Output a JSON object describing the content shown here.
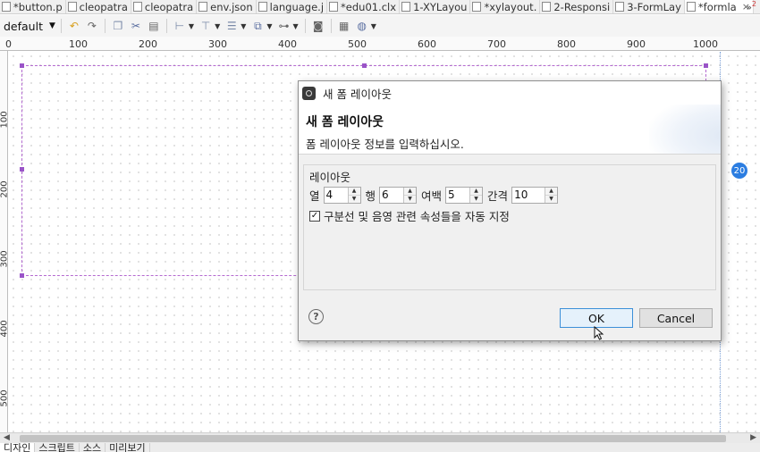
{
  "tabs": [
    {
      "label": "*button.p",
      "active": false
    },
    {
      "label": "cleopatra",
      "active": false
    },
    {
      "label": "cleopatra",
      "active": false
    },
    {
      "label": "env.json",
      "active": false
    },
    {
      "label": "language.j",
      "active": false
    },
    {
      "label": "*edu01.clx",
      "active": false
    },
    {
      "label": "1-XYLayou",
      "active": false
    },
    {
      "label": "*xylayout.",
      "active": false
    },
    {
      "label": "2-Responsi",
      "active": false
    },
    {
      "label": "3-FormLay",
      "active": false
    },
    {
      "label": "*formla",
      "active": true
    }
  ],
  "tab_close_label": "×",
  "tab_overflow": {
    "label": "»",
    "count": "2"
  },
  "toolbar": {
    "theme_combo": {
      "value": "default"
    },
    "buttons": [
      "undo-icon",
      "redo-icon",
      "copy-icon",
      "cut-icon",
      "paste-icon",
      "align-left-icon",
      "align-top-icon",
      "distribute-icon",
      "group-icon",
      "link-icon",
      "screenshot-icon",
      "qr-icon",
      "globe-icon"
    ]
  },
  "ruler": {
    "h_labels": [
      "0",
      "100",
      "200",
      "300",
      "400",
      "500",
      "600",
      "700",
      "800",
      "900",
      "1000"
    ],
    "v_labels": [
      "100",
      "200",
      "300",
      "400",
      "500"
    ]
  },
  "canvas": {
    "badge": "20"
  },
  "bottom_tabs": [
    {
      "label": "디자인",
      "active": true
    },
    {
      "label": "스크립트",
      "active": false
    },
    {
      "label": "소스",
      "active": false
    },
    {
      "label": "미리보기",
      "active": false
    }
  ],
  "dialog": {
    "title": "새 폼 레이아웃",
    "heading": "새 폼 레이아웃",
    "description": "폼 레이아웃 정보를 입력하십시오.",
    "group_label": "레이아웃",
    "fields": {
      "columns": {
        "label": "열",
        "value": "4"
      },
      "rows": {
        "label": "행",
        "value": "6"
      },
      "margin": {
        "label": "여백",
        "value": "5"
      },
      "spacing": {
        "label": "간격",
        "value": "10"
      }
    },
    "auto_checkbox": {
      "label": "구분선 및 음영 관련 속성들을 자동 지정",
      "checked": true
    },
    "help_label": "?",
    "ok_label": "OK",
    "cancel_label": "Cancel"
  },
  "colors": {
    "selection": "#b46ad0",
    "accent": "#2b7de1",
    "dialog_bg": "#f0f0f0",
    "default_button_border": "#3c8fd8"
  }
}
